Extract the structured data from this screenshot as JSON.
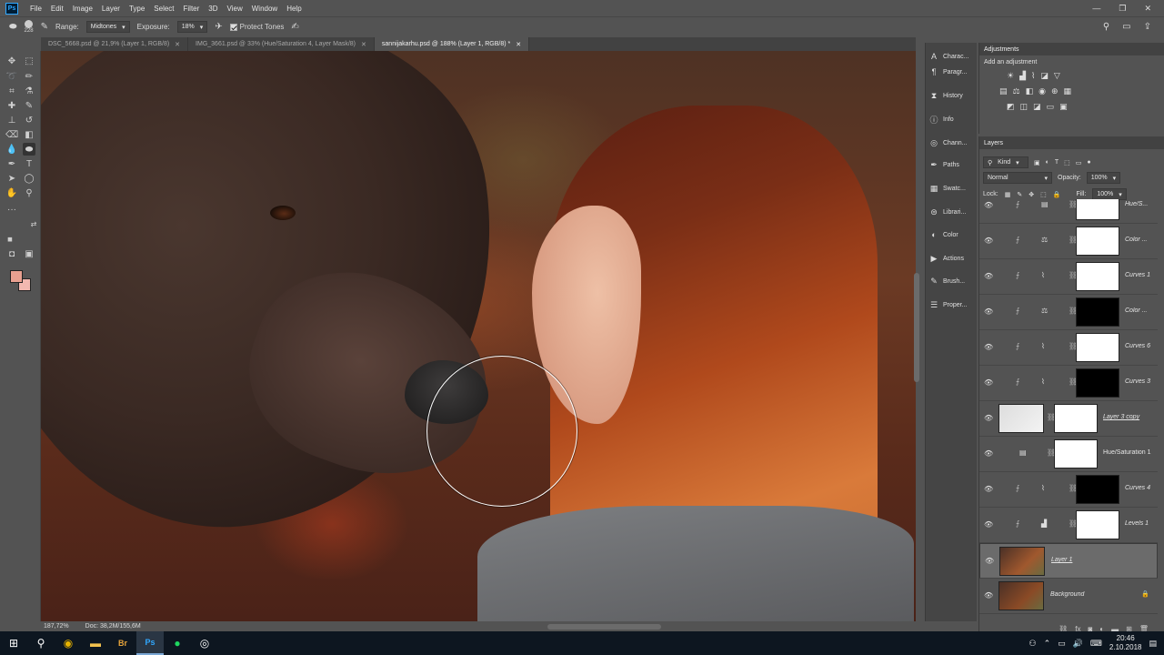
{
  "app": {
    "logo_text": "Ps"
  },
  "menu": [
    "File",
    "Edit",
    "Image",
    "Layer",
    "Type",
    "Select",
    "Filter",
    "3D",
    "View",
    "Window",
    "Help"
  ],
  "options": {
    "brush_size": "228",
    "range_label": "Range:",
    "range_value": "Midtones",
    "exposure_label": "Exposure:",
    "exposure_value": "18%",
    "protect_tones": "Protect Tones"
  },
  "tabs": [
    {
      "label": "DSC_5668.psd @ 21,9% (Layer 1, RGB/8)"
    },
    {
      "label": "IMG_3661.psd @ 33% (Hue/Saturation 4, Layer Mask/8)"
    },
    {
      "label": "sannijakarhu.psd @ 188% (Layer 1, RGB/8) *"
    }
  ],
  "status": {
    "zoom": "187,72%",
    "doc": "Doc: 38,2M/155,6M"
  },
  "colors": {
    "foreground": "#e8a090",
    "background": "#f2b8b0"
  },
  "dock": [
    {
      "label": "Charac...",
      "icon": "character-icon"
    },
    {
      "label": "Paragr...",
      "icon": "paragraph-icon"
    },
    {
      "label": "History",
      "icon": "history-icon"
    },
    {
      "label": "Info",
      "icon": "info-icon"
    },
    {
      "label": "Chann...",
      "icon": "channels-icon"
    },
    {
      "label": "Paths",
      "icon": "paths-icon"
    },
    {
      "label": "Swatc...",
      "icon": "swatches-icon"
    },
    {
      "label": "Librari...",
      "icon": "libraries-icon"
    },
    {
      "label": "Color",
      "icon": "color-icon"
    },
    {
      "label": "Actions",
      "icon": "actions-icon"
    },
    {
      "label": "Brush...",
      "icon": "brush-icon"
    },
    {
      "label": "Proper...",
      "icon": "properties-icon"
    }
  ],
  "adjustments": {
    "title": "Adjustments",
    "subtitle": "Add an adjustment"
  },
  "layers_panel": {
    "title": "Layers",
    "filter": "Kind",
    "blend_mode": "Normal",
    "opacity_label": "Opacity:",
    "opacity_value": "100%",
    "lock_label": "Lock:",
    "fill_label": "Fill:",
    "fill_value": "100%",
    "layers": [
      {
        "name": "Hue/S...",
        "mask": "white"
      },
      {
        "name": "Color ...",
        "mask": "white"
      },
      {
        "name": "Curves 1",
        "mask": "white"
      },
      {
        "name": "Color ...",
        "mask": "black"
      },
      {
        "name": "Curves 6",
        "mask": "white"
      },
      {
        "name": "Curves 3",
        "mask": "black"
      },
      {
        "name": "Layer 3 copy",
        "mask": "white"
      },
      {
        "name": "Hue/Saturation 1",
        "mask": "white"
      },
      {
        "name": "Curves 4",
        "mask": "black"
      },
      {
        "name": "Levels 1",
        "mask": "white"
      },
      {
        "name": "Layer 1",
        "mask": "none"
      },
      {
        "name": "Background",
        "mask": "none"
      }
    ]
  },
  "taskbar": {
    "time": "20:46",
    "date": "2.10.2018"
  }
}
